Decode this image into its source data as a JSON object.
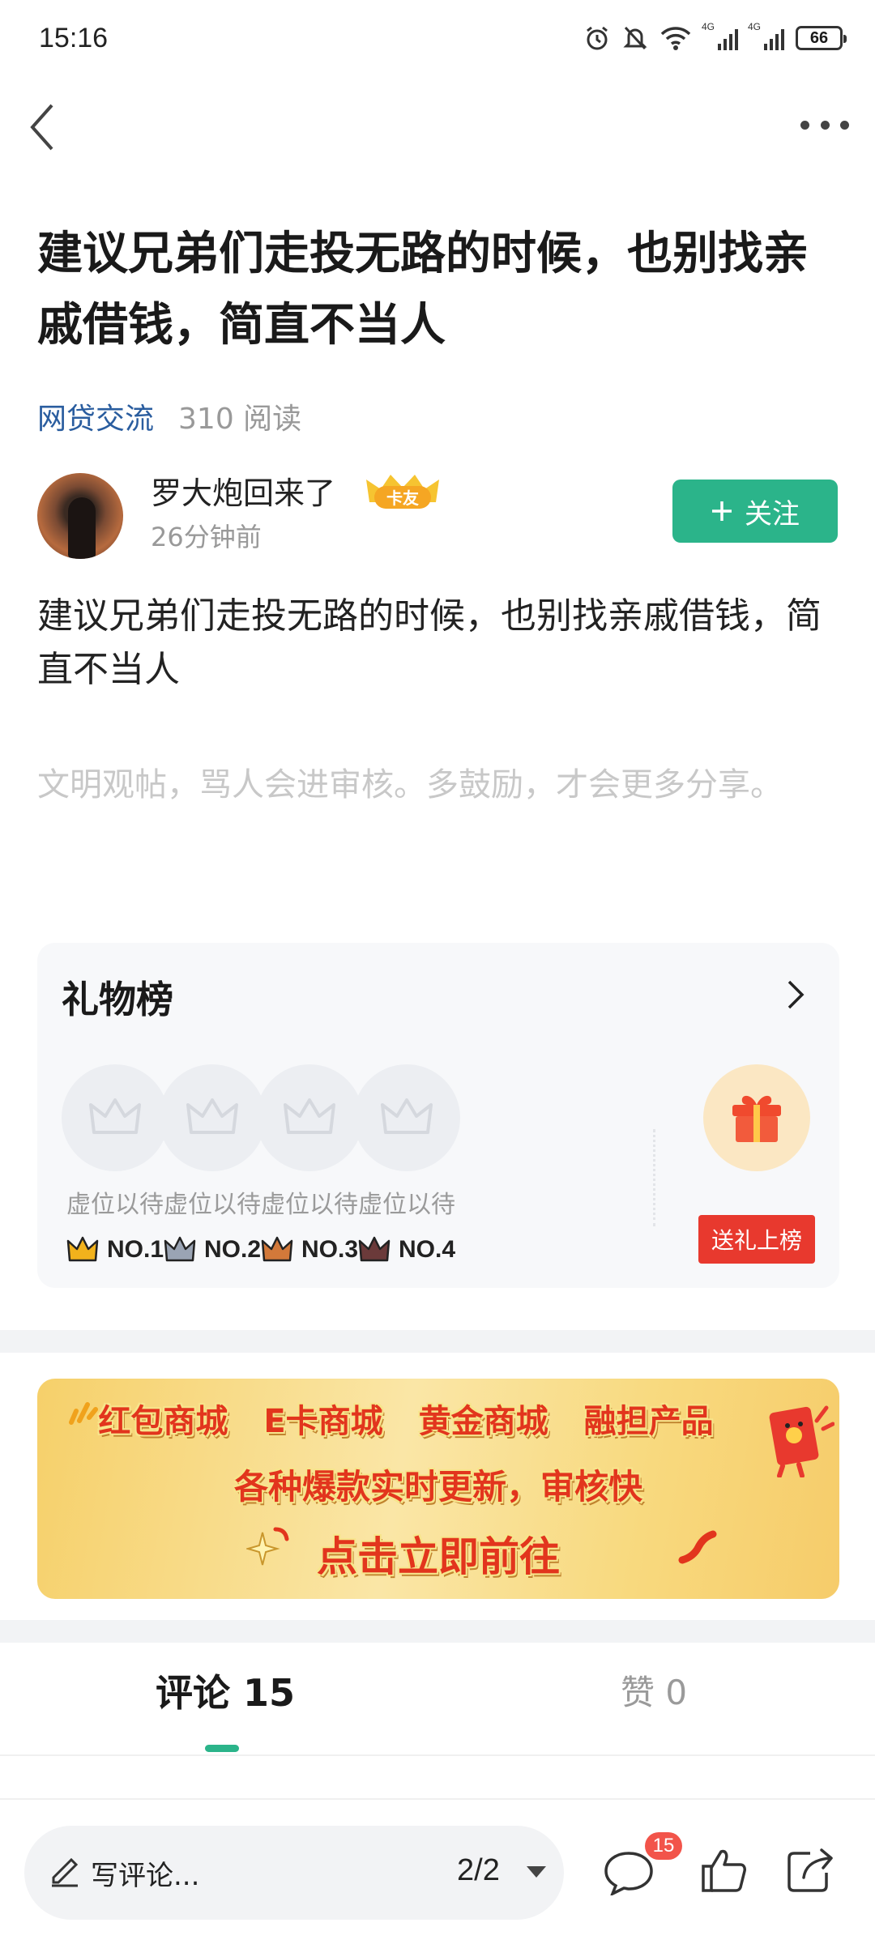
{
  "status_bar": {
    "time": "15:16",
    "battery": "66",
    "signal_tags": [
      "4G",
      "4G"
    ],
    "icons": [
      "alarm-icon",
      "mute-icon",
      "wifi-icon",
      "signal-icon",
      "signal-icon",
      "battery-icon"
    ]
  },
  "nav": {
    "back_icon": "chevron-left-icon",
    "more_icon": "more-dots-icon"
  },
  "post": {
    "title": "建议兄弟们走投无路的时候，也别找亲戚借钱，简直不当人",
    "category": "网贷交流",
    "reads": "310 阅读",
    "body": "建议兄弟们走投无路的时候，也别找亲戚借钱，简直不当人",
    "notice": "文明观帖，骂人会进审核。多鼓励，才会更多分享。"
  },
  "author": {
    "name": "罗大炮回来了",
    "badge": "卡友",
    "time": "26分钟前",
    "follow_label": "关注"
  },
  "gift_board": {
    "title": "礼物榜",
    "slots": [
      {
        "label": "虚位以待",
        "rank": "NO.1",
        "color": "#f2b21c"
      },
      {
        "label": "虚位以待",
        "rank": "NO.2",
        "color": "#9aa4b4"
      },
      {
        "label": "虚位以待",
        "rank": "NO.3",
        "color": "#d3793a"
      },
      {
        "label": "虚位以待",
        "rank": "NO.4",
        "color": "#6b3a3a"
      }
    ],
    "send_label": "送礼上榜"
  },
  "banner": {
    "items": [
      "红包商城",
      "E卡商城",
      "黄金商城",
      "融担产品"
    ],
    "line2": "各种爆款实时更新，审核快",
    "line3": "点击立即前往"
  },
  "tabs": {
    "comment_label": "评论 15",
    "like_label": "赞 0"
  },
  "bottom_bar": {
    "write_label": "写评论...",
    "page_indicator": "2/2",
    "comment_count": "15"
  },
  "colors": {
    "accent": "#2bb48a",
    "link": "#2a5d9f",
    "danger": "#e8392e"
  }
}
